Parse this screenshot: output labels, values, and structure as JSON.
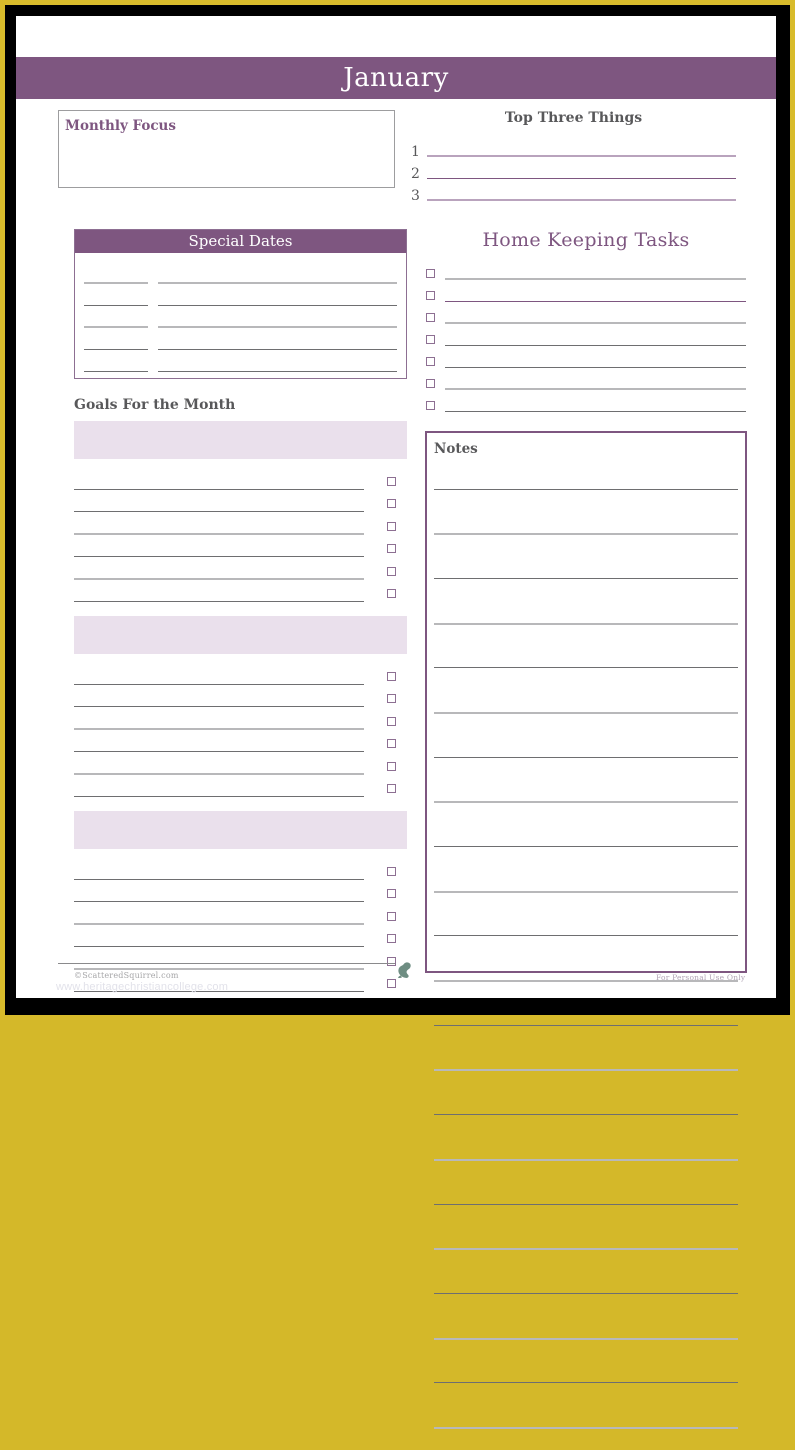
{
  "page": {
    "month_title": "January",
    "accent_purple": "#7e5680",
    "band_lavender": "#eae0ec",
    "frame_gold": "#d8bb2b"
  },
  "monthly_focus": {
    "label": "Monthly Focus"
  },
  "top_three": {
    "heading": "Top Three Things",
    "items": [
      "1",
      "2",
      "3"
    ]
  },
  "special_dates": {
    "heading": "Special Dates",
    "row_count": 5
  },
  "home_keeping": {
    "heading": "Home Keeping Tasks",
    "row_count": 7
  },
  "goals": {
    "heading": "Goals For the Month",
    "blocks": 3,
    "rows_per_block": 6
  },
  "notes": {
    "label": "Notes",
    "line_count": 22
  },
  "footer": {
    "copyright": "©ScatteredSquirrel.com",
    "watermark": "www.heritagechristiancollege.com",
    "personal_use": "For Personal Use Only",
    "logo": "squirrel-icon"
  }
}
